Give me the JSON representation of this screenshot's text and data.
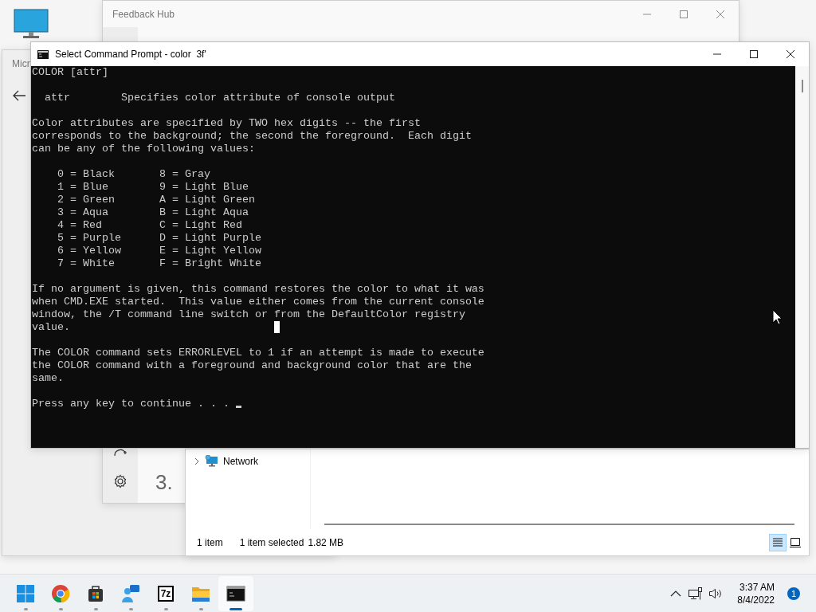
{
  "background_window": {
    "title": "Micr"
  },
  "feedback_hub": {
    "title": "Feedback Hub",
    "heading": "3."
  },
  "file_explorer": {
    "nav_items": [
      {
        "label": "Network",
        "expanded": false
      }
    ],
    "status": {
      "count": "1 item",
      "selection": "1 item selected",
      "size": "1.82 MB"
    },
    "view_buttons": [
      {
        "kind": "details",
        "selected": true
      },
      {
        "kind": "tiles",
        "selected": false
      }
    ]
  },
  "console_window": {
    "title": "Select Command Prompt - color  3f'",
    "blocks": [
      [
        "COLOR [attr]"
      ],
      [
        "  attr        Specifies color attribute of console output"
      ],
      [
        "Color attributes are specified by TWO hex digits -- the first",
        "corresponds to the background; the second the foreground.  Each digit",
        "can be any of the following values:"
      ],
      [
        "    0 = Black       8 = Gray",
        "    1 = Blue        9 = Light Blue",
        "    2 = Green       A = Light Green",
        "    3 = Aqua        B = Light Aqua",
        "    4 = Red         C = Light Red",
        "    5 = Purple      D = Light Purple",
        "    6 = Yellow      E = Light Yellow",
        "    7 = White       F = Bright White"
      ],
      [
        "If no argument is given, this command restores the color to what it was",
        "when CMD.EXE started.  This value either comes from the current console",
        "window, the /T command line switch or from the DefaultColor registry",
        "value."
      ],
      [
        "The COLOR command sets ERRORLEVEL to 1 if an attempt is made to execute",
        "the COLOR command with a foreground and background color that are the",
        "same."
      ],
      [
        "Press any key to continue . . . "
      ]
    ]
  },
  "taskbar": {
    "apps": [
      {
        "kind": "start",
        "selected": false
      },
      {
        "kind": "browser",
        "selected": false
      },
      {
        "kind": "store",
        "selected": false
      },
      {
        "kind": "chat",
        "selected": false
      },
      {
        "kind": "archiver",
        "glyph": "7z",
        "selected": false
      },
      {
        "kind": "folder",
        "selected": false
      },
      {
        "kind": "terminal",
        "selected": true
      }
    ],
    "time": "3:37 AM",
    "date": "8/4/2022",
    "notification_count": "1"
  }
}
